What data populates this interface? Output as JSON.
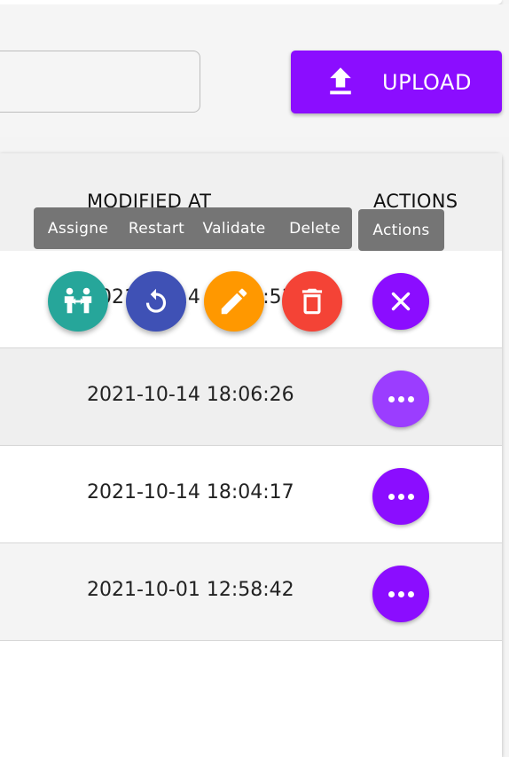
{
  "toolbar": {
    "search_placeholder": "",
    "upload_label": "UPLOAD"
  },
  "table": {
    "columns": {
      "modified_at": "MODIFIED AT",
      "actions": "ACTIONS"
    },
    "rows": [
      {
        "modified_at": "2021-10-14 18:20:53"
      },
      {
        "modified_at": "2021-10-14 18:06:26"
      },
      {
        "modified_at": "2021-10-14 18:04:17"
      },
      {
        "modified_at": "2021-10-01 12:58:42"
      }
    ]
  },
  "speed_dial": {
    "tooltips": {
      "assigne": "Assigne",
      "restart": "Restart",
      "validate": "Validate",
      "delete": "Delete",
      "actions": "Actions"
    },
    "icons": [
      "assign-icon",
      "restart-icon",
      "edit-icon",
      "delete-icon",
      "close-icon"
    ]
  },
  "colors": {
    "accent": "#8b0dff",
    "assign": "#26a69a",
    "restart": "#3f51b5",
    "validate": "#ff9800",
    "delete": "#f44336",
    "tooltip": "#757575"
  }
}
